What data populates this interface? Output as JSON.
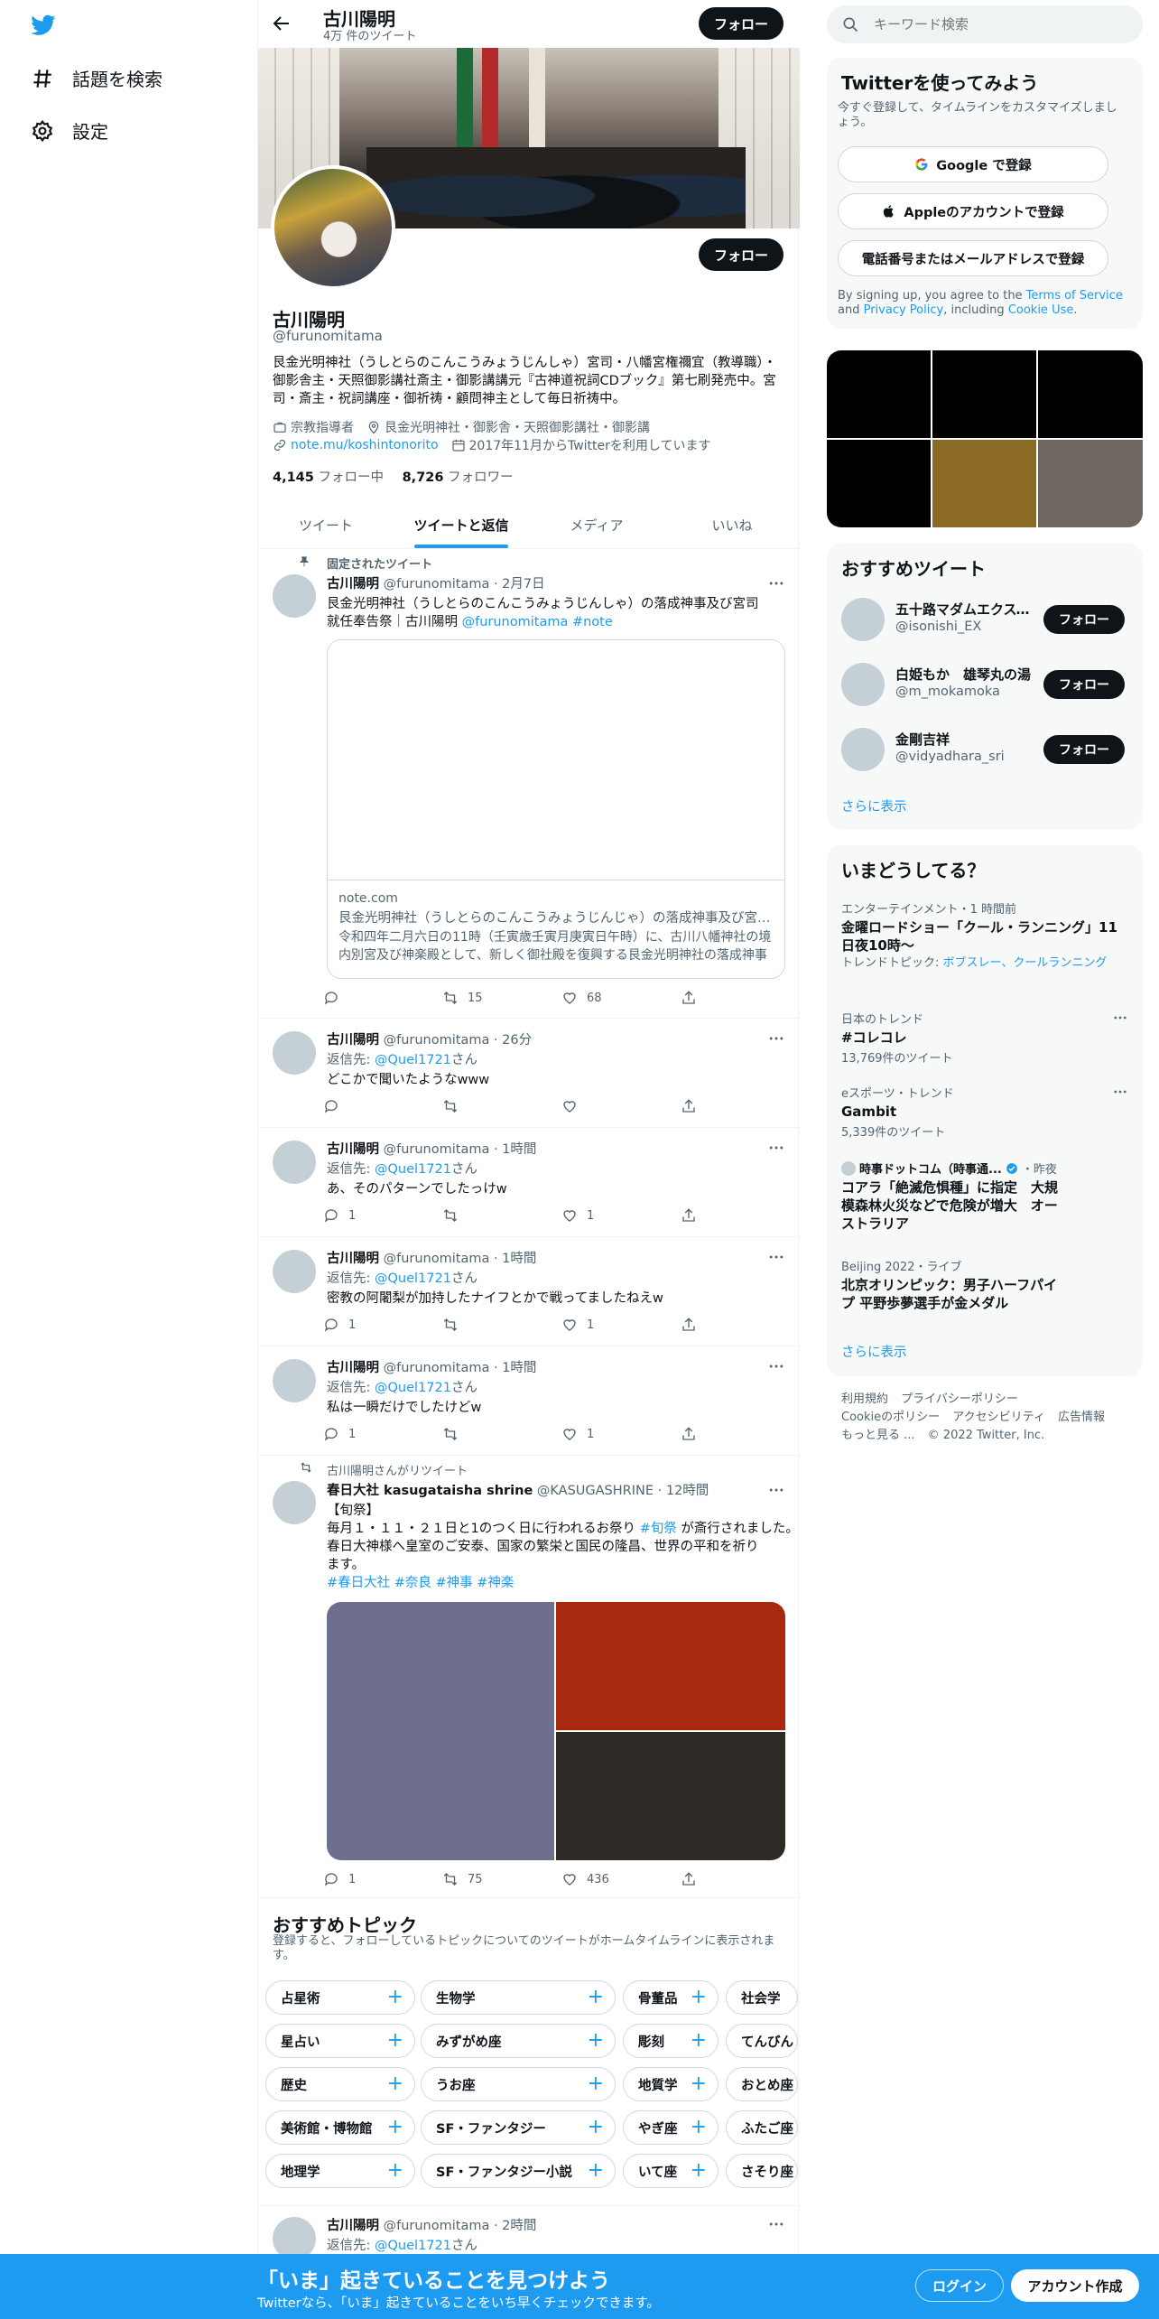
{
  "nav": {
    "explore_label": "話題を検索",
    "settings_label": "設定"
  },
  "header": {
    "name": "古川陽明",
    "tweet_count": "4万 件のツイート",
    "follow_label": "フォロー"
  },
  "profile": {
    "name": "古川陽明",
    "handle": "@furunomitama",
    "bio": "艮金光明神社（うしとらのこんこうみょうじんしゃ）宮司・八幡宮権禰宜（教導職）・御影舎主・天照御影講社斎主・御影講講元『古神道祝詞CDブック』第七刷発売中。宮司・斎主・祝詞講座・御祈祷・顧問神主として毎日祈祷中。",
    "category": "宗教指導者",
    "location": "艮金光明神社・御影舎・天照御影講社・御影講",
    "link": "note.mu/koshintonorito",
    "joined": "2017年11月からTwitterを利用しています",
    "following_count": "4,145",
    "following_label": "フォロー中",
    "followers_count": "8,726",
    "followers_label": "フォロワー",
    "follow_label": "フォロー"
  },
  "tabs": [
    "ツイート",
    "ツイートと返信",
    "メディア",
    "いいね"
  ],
  "tweets": {
    "pinned": {
      "pinned_label": "固定されたツイート",
      "name": "古川陽明",
      "handle_time": "@furunomitama · 2月7日",
      "text_line1": "艮金光明神社（うしとらのこんこうみょうじんしゃ）の落成神事及び宮司",
      "text_line2_a": "就任奉告祭｜古川陽明 ",
      "text_line2_b": "@furunomitama",
      "text_line2_c": " #note",
      "card_domain": "note.com",
      "card_title": "艮金光明神社（うしとらのこんこうみょうじんじゃ）の落成神事及び宮司就任奉告祭｜古川陽明",
      "card_desc": "令和四年二月六日の11時（壬寅歳壬寅月庚寅日午時）に、古川八幡神社の境内別宮及び神楽殿として、新しく御社殿を復興する艮金光明神社の落成神事を執り行いました。",
      "retweets": "15",
      "likes": "68"
    },
    "t2": {
      "name": "古川陽明",
      "handle_time": "@furunomitama · 26分",
      "reply_to_label": "返信先: ",
      "reply_to": "@Quel1721",
      "reply_suffix": "さん",
      "text": "どこかで聞いたようなwww",
      "replies": "",
      "likes": ""
    },
    "t3": {
      "name": "古川陽明",
      "handle_time": "@furunomitama · 1時間",
      "reply_to_label": "返信先: ",
      "reply_to": "@Quel1721",
      "reply_suffix": "さん",
      "text": "あ、そのパターンでしたっけw",
      "replies": "1",
      "likes": "1"
    },
    "t4": {
      "name": "古川陽明",
      "handle_time": "@furunomitama · 1時間",
      "reply_to_label": "返信先: ",
      "reply_to": "@Quel1721",
      "reply_suffix": "さん",
      "text": "密教の阿闍梨が加持したナイフとかで戦ってましたねえw",
      "replies": "1",
      "likes": "1"
    },
    "t5": {
      "name": "古川陽明",
      "handle_time": "@furunomitama · 1時間",
      "reply_to_label": "返信先: ",
      "reply_to": "@Quel1721",
      "reply_suffix": "さん",
      "text": "私は一瞬だけでしたけどw",
      "replies": "1",
      "likes": "1"
    },
    "rt": {
      "retweeted_by": "古川陽明さんがリツイート",
      "name": "春日大社 kasugataisha shrine",
      "handle_time": "@KASUGASHRINE · 12時間",
      "line1": "【旬祭】",
      "line2_a": "毎月１・１１・２１日と1のつく日に行われるお祭り ",
      "line2_b": "#旬祭",
      "line2_c": " が斎行されました。",
      "line3": "春日大神様へ皇室のご安泰、国家の繁栄と国民の隆昌、世界の平和を祈り",
      "line4": "ます。",
      "hashtags": "#春日大社 #奈良 #神事 #神楽",
      "replies": "1",
      "retweets": "75",
      "likes": "436"
    },
    "last": {
      "name": "古川陽明",
      "handle_time": "@furunomitama · 2時間",
      "reply_to_label": "返信先: ",
      "reply_to": "@Quel1721",
      "reply_suffix": "さん"
    }
  },
  "topics": {
    "title": "おすすめトピック",
    "subtitle": "登録すると、フォローしているトピックについてのツイートがホームタイムラインに表示されます。",
    "row1": [
      "占星術",
      "生物学",
      "骨董品",
      "社会学"
    ],
    "row2": [
      "星占い",
      "みずがめ座",
      "彫刻",
      "てんびん"
    ],
    "row3": [
      "歴史",
      "うお座",
      "地質学",
      "おとめ座"
    ],
    "row4": [
      "美術館・博物館",
      "SF・ファンタジー",
      "やぎ座",
      "ふたご座"
    ],
    "row5": [
      "地理学",
      "SF・ファンタジー小説",
      "いて座",
      "さそり座"
    ]
  },
  "right": {
    "search_placeholder": "キーワード検索",
    "signup": {
      "title": "Twitterを使ってみよう",
      "subtitle": "今すぐ登録して、タイムラインをカスタマイズしましょう。",
      "google": "Google で登録",
      "apple": "Appleのアカウントで登録",
      "phone": "電話番号またはメールアドレスで登録",
      "terms_a": "By signing up, you agree to the ",
      "terms_b": "Terms of Service",
      "terms_c": " and ",
      "terms_d": "Privacy Policy",
      "terms_e": ", including ",
      "terms_f": "Cookie Use",
      "terms_g": "."
    },
    "recommended": {
      "title": "おすすめツイート",
      "users": [
        {
          "name": "五十路マダムエクスペリエンス",
          "handle": "@isonishi_EX"
        },
        {
          "name": "白姫もか　雄琴丸の湯",
          "handle": "@m_mokamoka"
        },
        {
          "name": "金剛吉祥",
          "handle": "@vidyadhara_sri"
        }
      ],
      "follow_label": "フォロー",
      "more": "さらに表示"
    },
    "trends": {
      "title": "いまどうしてる？",
      "t1": {
        "category": "エンターテインメント・1 時間前",
        "title": "金曜ロードショー「クール・ランニング」11日夜10時〜",
        "sub_label": "トレンドトピック: ",
        "sub_value": "ボブスレー、クールランニング"
      },
      "t2": {
        "category": "日本のトレンド",
        "title": "#コレコレ",
        "count": "13,769件のツイート"
      },
      "t3": {
        "category": "eスポーツ・トレンド",
        "title": "Gambit",
        "count": "5,339件のツイート"
      },
      "t4": {
        "source": "時事ドットコム（時事通...",
        "time": "・昨夜",
        "title": "コアラ「絶滅危惧種」に指定　大規模森林火災などで危険が増大　オーストラリア"
      },
      "t5": {
        "category": "Beijing 2022・ライブ",
        "title": "北京オリンピック：男子ハーフパイプ 平野歩夢選手が金メダル"
      },
      "more": "さらに表示"
    },
    "footer": {
      "terms": "利用規約",
      "privacy": "プライバシーポリシー",
      "cookie": "Cookieのポリシー",
      "accessibility": "アクセシビリティ",
      "ads": "広告情報",
      "more": "もっと見る ...",
      "copyright": "© 2022 Twitter, Inc."
    }
  },
  "bottombar": {
    "title": "「いま」起きていることを見つけよう",
    "subtitle": "Twitterなら、「いま」起きていることをいち早くチェックできます。",
    "login": "ログイン",
    "signup": "アカウント作成"
  }
}
